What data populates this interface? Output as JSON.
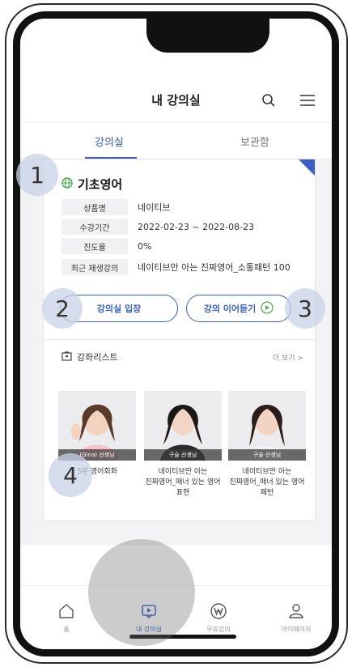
{
  "header": {
    "title": "내 강의실"
  },
  "tabs": [
    {
      "label": "강의실",
      "active": true
    },
    {
      "label": "보관함",
      "active": false
    }
  ],
  "card": {
    "title": "기초영어",
    "info": [
      {
        "label": "상품명",
        "value": "네이티브"
      },
      {
        "label": "수강기간",
        "value": "2022-02-23 ~ 2022-08-23"
      },
      {
        "label": "진도율",
        "value": "0%"
      },
      {
        "label": "최근 재생강의",
        "value": "네이티브만 아는 진짜영어_소통패턴 100"
      }
    ],
    "enter_button": "강의실 입장",
    "resume_button": "강의 이어듣기",
    "section_title": "강좌리스트",
    "more_link": "더 보기 >",
    "courses": [
      {
        "teacher": "(Gina) 선생님",
        "title_lines": [
          "5분 영어회화"
        ]
      },
      {
        "teacher": "구슬 선생님",
        "title_lines": [
          "네이티브만 아는",
          "진짜영어_매너 있는 영어",
          "표현"
        ]
      },
      {
        "teacher": "구슬 선생님",
        "title_lines": [
          "네이티브만 아는",
          "진짜영어_매너 있는 영어",
          "패턴"
        ]
      }
    ]
  },
  "bottom_nav": [
    {
      "label": "홈",
      "icon": "home-icon"
    },
    {
      "label": "내 강의실",
      "icon": "lecture-room-icon",
      "active": true
    },
    {
      "label": "무료강의",
      "icon": "won-icon"
    },
    {
      "label": "마이페이지",
      "icon": "person-icon"
    }
  ],
  "markers": [
    "1",
    "2",
    "3",
    "4"
  ],
  "colors": {
    "accent": "#3a5ec2",
    "globe": "#4caf50"
  }
}
